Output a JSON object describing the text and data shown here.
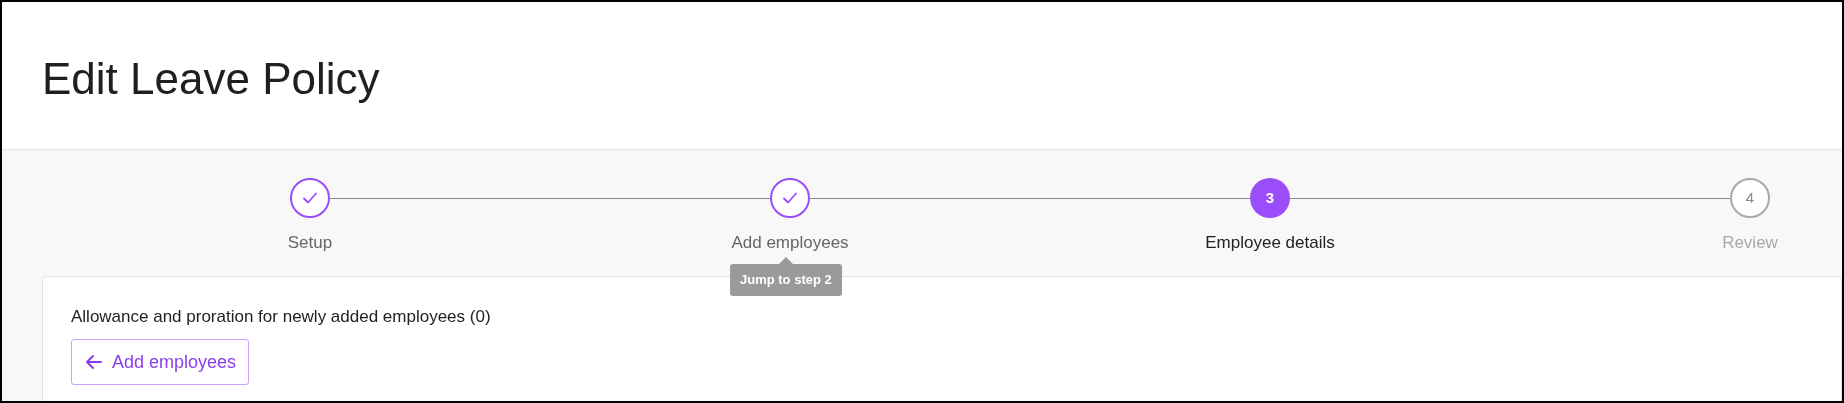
{
  "page": {
    "title": "Edit Leave Policy"
  },
  "steps": [
    {
      "label": "Setup",
      "completed": true,
      "selected": false
    },
    {
      "label": "Add employees",
      "completed": true,
      "selected": false
    },
    {
      "label": "Employee details",
      "completed": false,
      "selected": true,
      "number": "3"
    },
    {
      "label": "Review",
      "completed": false,
      "selected": false,
      "number": "4"
    }
  ],
  "tooltip": {
    "text": "Jump to step 2"
  },
  "section": {
    "heading": "Allowance and proration for newly added employees (0)",
    "button": "Add employees"
  }
}
